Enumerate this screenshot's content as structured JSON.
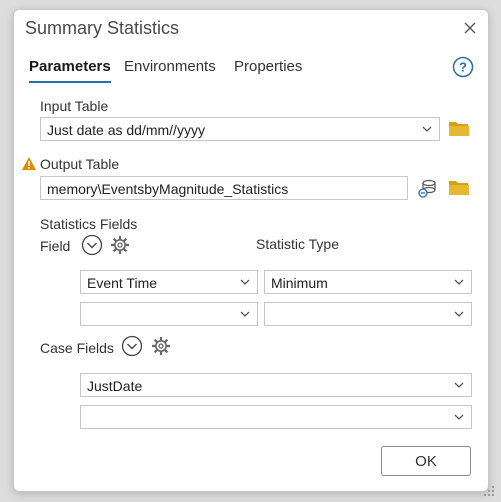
{
  "dialog": {
    "title": "Summary Statistics",
    "ok_label": "OK"
  },
  "tabs": [
    "Parameters",
    "Environments",
    "Properties"
  ],
  "input_table": {
    "label": "Input Table",
    "value": "Just date as dd/mm//yyyy"
  },
  "output_table": {
    "label": "Output Table",
    "value": "memory\\EventsbyMagnitude_Statistics"
  },
  "statistics": {
    "section_label": "Statistics Fields",
    "field_label": "Field",
    "type_label": "Statistic Type",
    "rows": [
      {
        "field": "Event Time",
        "type": "Minimum"
      },
      {
        "field": "",
        "type": ""
      }
    ]
  },
  "case_fields": {
    "label": "Case Fields",
    "rows": [
      "JustDate",
      ""
    ]
  },
  "icons": {
    "close": "close-icon",
    "help": "help-icon",
    "folder": "folder-icon",
    "warning": "warning-icon",
    "add_field": "chevron-circle-icon",
    "settings": "gear-icon",
    "database": "database-icon"
  },
  "colors": {
    "accent": "#2b6cb0",
    "folder": "#d4a017",
    "warning": "#e08a00"
  }
}
